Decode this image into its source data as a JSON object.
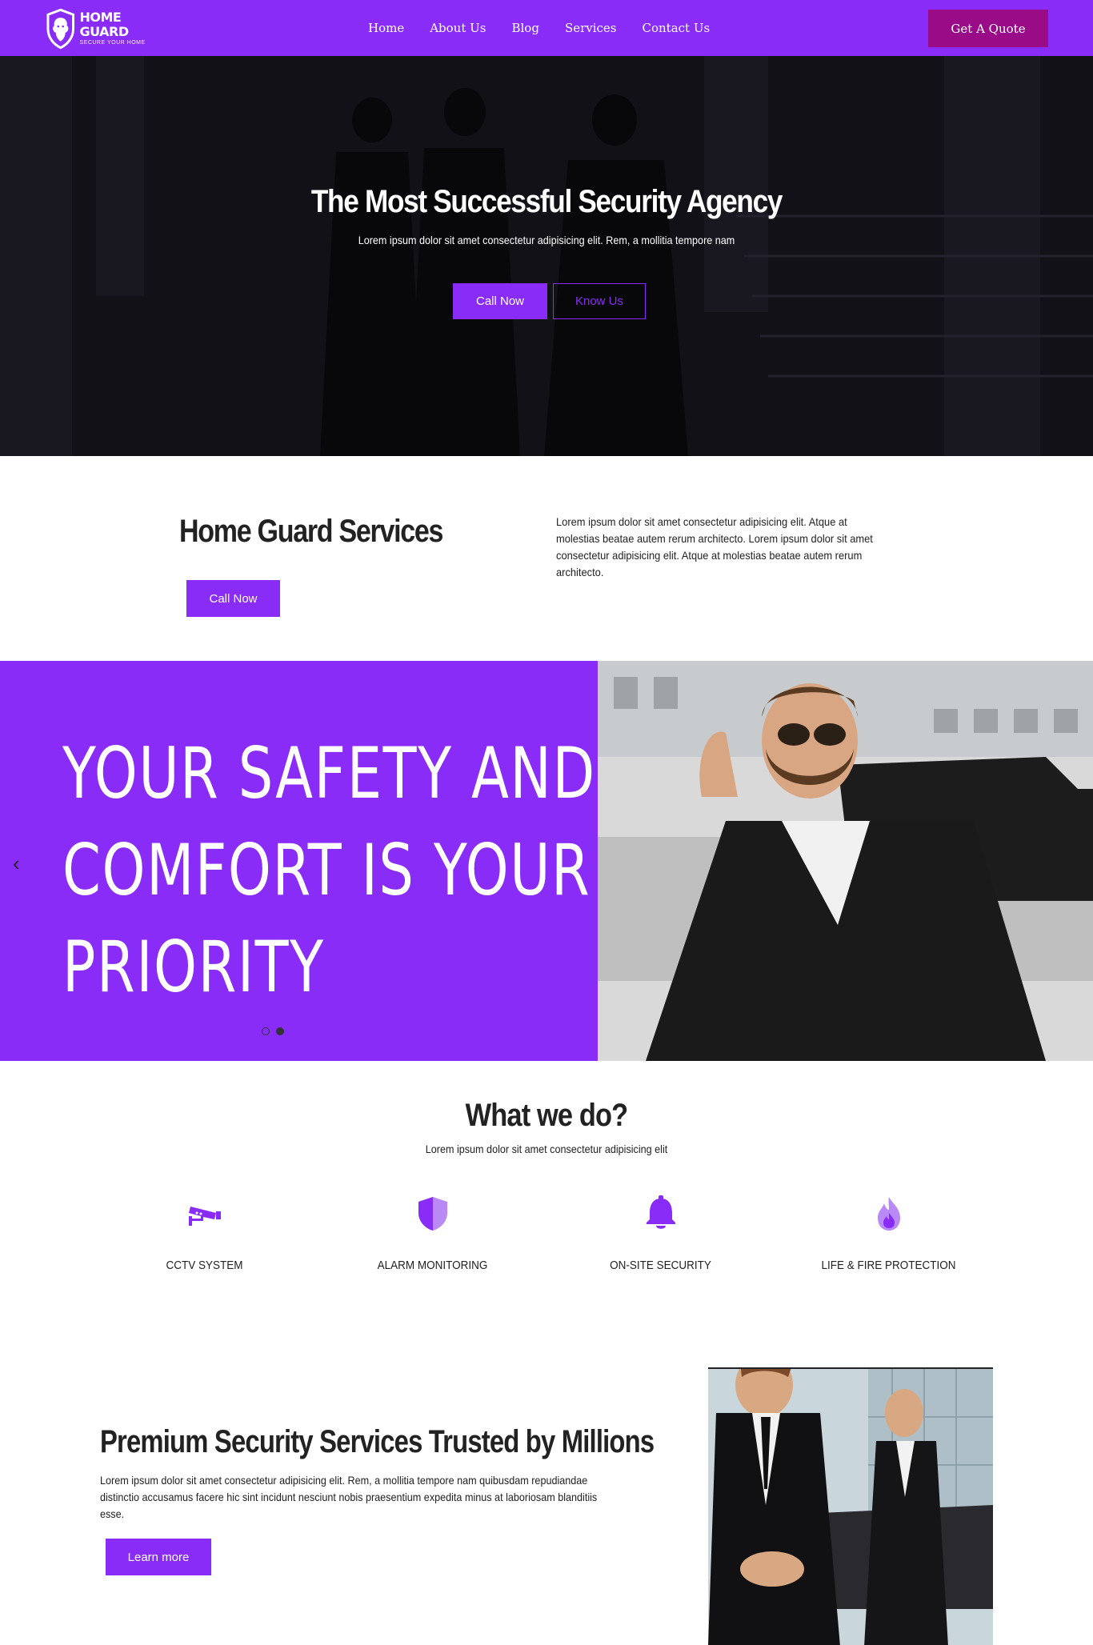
{
  "brand": {
    "name": "HOME GUARD",
    "tagline": "SECURE YOUR HOME",
    "accent": "#8a2cf8",
    "quote_color": "#9a0b87"
  },
  "nav": {
    "items": [
      "Home",
      "About Us",
      "Blog",
      "Services",
      "Contact Us"
    ],
    "quote_label": "Get A Quote"
  },
  "hero": {
    "title": "The Most Successful Security Agency",
    "subtitle": "Lorem ipsum dolor sit amet consectetur adipisicing elit. Rem, a mollitia tempore nam",
    "primary_label": "Call Now",
    "secondary_label": "Know Us"
  },
  "services": {
    "title": "Home Guard Services",
    "button_label": "Call Now",
    "text": "Lorem ipsum dolor sit amet consectetur adipisicing elit. Atque at molestias beatae autem rerum architecto. Lorem ipsum dolor sit amet consectetur adipisicing elit. Atque at molestias beatae autem rerum architecto."
  },
  "slider": {
    "lines": [
      "YOUR SAFETY AND",
      "COMFORT IS YOUR",
      "PRIORITY"
    ],
    "prev_icon": "chevron-left-icon",
    "dots": 2,
    "active_dot": 2
  },
  "what_we_do": {
    "title": "What we do?",
    "subtitle": "Lorem ipsum dolor sit amet consectetur adipisicing elit",
    "features": [
      {
        "label": "CCTV SYSTEM",
        "icon": "cctv-camera-icon"
      },
      {
        "label": "ALARM MONITORING",
        "icon": "shield-icon"
      },
      {
        "label": "ON-SITE SECURITY",
        "icon": "bell-icon"
      },
      {
        "label": "LIFE & FIRE PROTECTION",
        "icon": "fire-icon"
      }
    ]
  },
  "premium": {
    "title": "Premium Security Services Trusted by Millions",
    "text": "Lorem ipsum dolor sit amet consectetur adipisicing elit. Rem, a mollitia tempore nam quibusdam repudiandae distinctio accusamus facere hic sint incidunt nesciunt nobis praesentium expedita minus at laboriosam blanditiis esse.",
    "button_label": "Learn more"
  }
}
